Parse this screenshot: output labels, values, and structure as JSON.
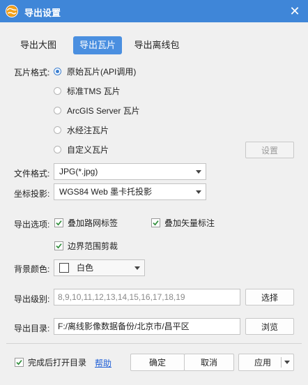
{
  "window": {
    "title": "导出设置"
  },
  "tabs": [
    {
      "label": "导出大图",
      "active": false
    },
    {
      "label": "导出瓦片",
      "active": true
    },
    {
      "label": "导出离线包",
      "active": false
    }
  ],
  "tile_format": {
    "label": "瓦片格式:",
    "options": [
      {
        "label": "原始瓦片(API调用)",
        "checked": true
      },
      {
        "label": "标准TMS 瓦片",
        "checked": false
      },
      {
        "label": "ArcGIS Server 瓦片",
        "checked": false
      },
      {
        "label": "水经注瓦片",
        "checked": false
      },
      {
        "label": "自定义瓦片",
        "checked": false
      }
    ],
    "settings_button": "设置"
  },
  "file_format": {
    "label": "文件格式:",
    "value": "JPG(*.jpg)"
  },
  "projection": {
    "label": "坐标投影:",
    "value": "WGS84 Web 墨卡托投影"
  },
  "export_options": {
    "label": "导出选项:",
    "road_labels": {
      "label": "叠加路网标签",
      "checked": true
    },
    "vector_labels": {
      "label": "叠加矢量标注",
      "checked": true
    },
    "clip_boundary": {
      "label": "边界范围剪裁",
      "checked": true
    }
  },
  "background_color": {
    "label": "背景颜色:",
    "value": "白色",
    "swatch": "#ffffff"
  },
  "export_levels": {
    "label": "导出级别:",
    "value": "8,9,10,11,12,13,14,15,16,17,18,19",
    "button": "选择"
  },
  "export_dir": {
    "label": "导出目录:",
    "value": "F:/离线影像数据备份/北京市/昌平区",
    "button": "浏览"
  },
  "footer": {
    "open_after": {
      "label": "完成后打开目录",
      "checked": true
    },
    "help_link": "帮助",
    "ok_button": "确定",
    "cancel_button": "取消",
    "apply_button": "应用"
  },
  "colors": {
    "title_bar": "#3f86d8",
    "accent": "#4a8fe0",
    "check": "#2f8d3a",
    "link": "#1f5fd6"
  }
}
